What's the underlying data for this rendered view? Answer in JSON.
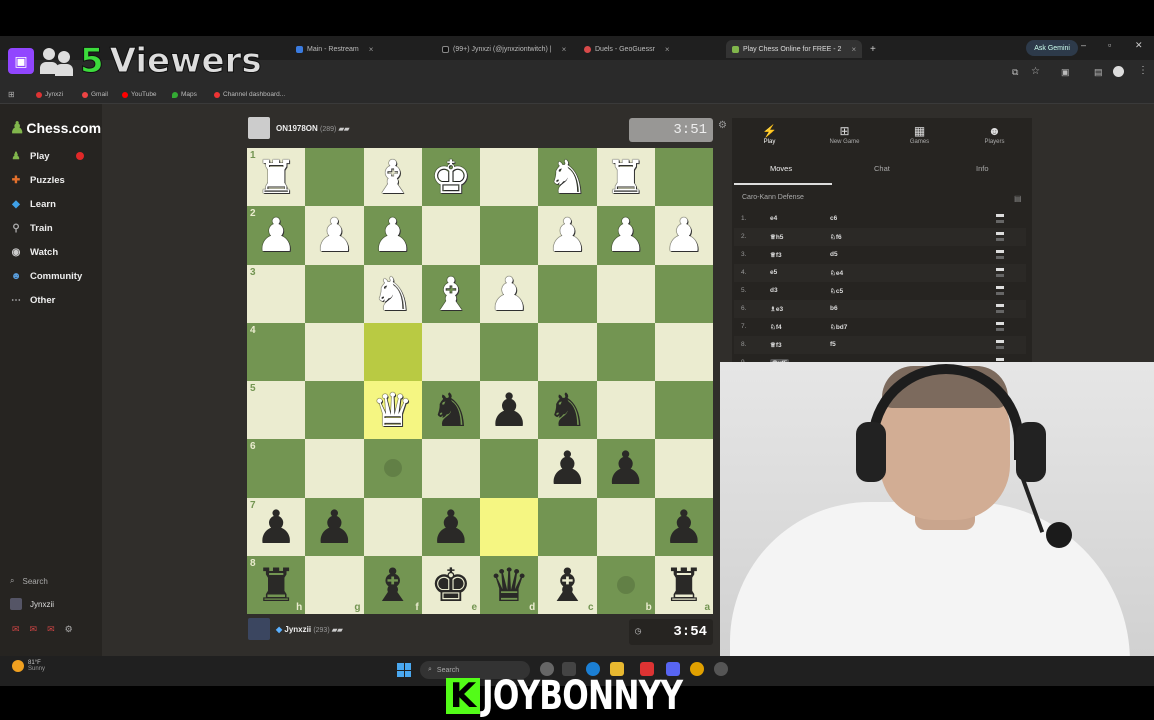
{
  "overlay": {
    "viewer_count": "5",
    "viewer_label": "Viewers"
  },
  "browser": {
    "tabs": [
      {
        "title": "Main - Restream",
        "active": false
      },
      {
        "title": "(99+) Jynxzi (@jynxziontwitch) |",
        "active": false
      },
      {
        "title": "Duels - GeoGuessr",
        "active": false
      },
      {
        "title": "Play Chess Online for FREE - 2",
        "active": true
      }
    ],
    "ask_gemini": "Ask Gemini",
    "bookmarks": [
      "Jynxzi",
      "Gmail",
      "YouTube",
      "Maps",
      "Channel dashboard..."
    ]
  },
  "sidebar": {
    "logo": "Chess.com",
    "items": [
      {
        "label": "Play",
        "icon": "play-icon"
      },
      {
        "label": "Puzzles",
        "icon": "puzzle-icon"
      },
      {
        "label": "Learn",
        "icon": "learn-icon"
      },
      {
        "label": "Train",
        "icon": "train-icon"
      },
      {
        "label": "Watch",
        "icon": "watch-icon"
      },
      {
        "label": "Community",
        "icon": "community-icon"
      },
      {
        "label": "Other",
        "icon": "more-icon"
      }
    ],
    "search": "Search",
    "user": "Jynxzii"
  },
  "game": {
    "opponent": {
      "name": "ON1978ON",
      "rating": "(289)",
      "clock": "3:51"
    },
    "player": {
      "name": "Jynxzii",
      "rating": "(293)",
      "clock": "3:54"
    }
  },
  "board": {
    "ranks": [
      "1",
      "2",
      "3",
      "4",
      "5",
      "6",
      "7",
      "8"
    ],
    "files": [
      "h",
      "g",
      "f",
      "e",
      "d",
      "c",
      "b",
      "a"
    ],
    "pieces": [
      "R.BK.NR",
      "PPP..PPP",
      "..NBP...",
      "........",
      "..Qnpn..",
      ".....pp.",
      "pp.p...p",
      "r.bkqb.r"
    ],
    "highlights": [
      [
        3,
        2
      ],
      [
        4,
        2
      ],
      [
        6,
        4
      ]
    ],
    "hints": [
      [
        5,
        2
      ],
      [
        7,
        6
      ]
    ]
  },
  "panel": {
    "tabs": [
      "Play",
      "New Game",
      "Games",
      "Players"
    ],
    "subtabs": [
      "Moves",
      "Chat",
      "Info"
    ],
    "opening": "Caro-Kann Defense",
    "moves": [
      {
        "n": "1.",
        "w": "e4",
        "b": "c6"
      },
      {
        "n": "2.",
        "w": "♕h5",
        "b": "♘f6"
      },
      {
        "n": "3.",
        "w": "♕f3",
        "b": "d5"
      },
      {
        "n": "4.",
        "w": "e5",
        "b": "♘e4"
      },
      {
        "n": "5.",
        "w": "d3",
        "b": "♘c5"
      },
      {
        "n": "6.",
        "w": "♗e3",
        "b": "b6"
      },
      {
        "n": "7.",
        "w": "♘f4",
        "b": "♘bd7"
      },
      {
        "n": "8.",
        "w": "♕f3",
        "b": "f5"
      },
      {
        "n": "9.",
        "w": "♕xf5",
        "b": ""
      }
    ]
  },
  "taskbar": {
    "weather": "81°F",
    "weather_sub": "Sunny",
    "search": "Search"
  },
  "caption": {
    "logo": "K",
    "name": "JOYBONNYY"
  }
}
